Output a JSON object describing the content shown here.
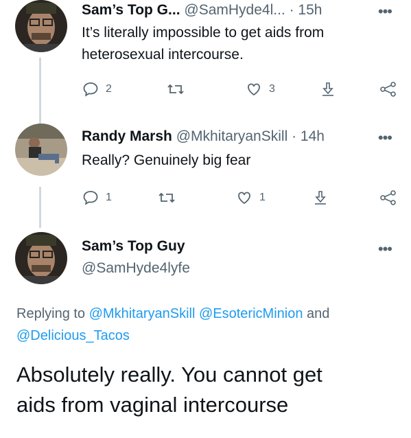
{
  "tweets": [
    {
      "name": "Sam’s Top G...",
      "handle": "@SamHyde4l...",
      "time": "· 15h",
      "more": "•••",
      "text_lines": [
        "It’s literally impossible to get aids from",
        "heterosexual intercourse."
      ],
      "replies": "2",
      "likes": "3"
    },
    {
      "name": "Randy Marsh",
      "handle": "@MkhitaryanSkill",
      "time": "· 14h",
      "more": "•••",
      "text_lines": [
        "Really? Genuinely big fear"
      ],
      "replies": "1",
      "likes": "1"
    }
  ],
  "focused": {
    "name": "Sam’s Top Guy",
    "handle": "@SamHyde4lyfe",
    "more": "•••",
    "replying_prefix": "Replying to",
    "replying_mentions": [
      "@MkhitaryanSkill",
      "@EsotericMinion",
      "@Delicious_Tacos"
    ],
    "replying_and": "and",
    "text_lines": [
      "Absolutely really. You cannot get",
      "aids from vaginal intercourse"
    ]
  },
  "icons": {
    "reply": "reply-icon",
    "retweet": "retweet-icon",
    "like": "heart-icon",
    "share": "share-icon",
    "nodes": "nodes-icon"
  },
  "colors": {
    "link": "#1d9bf0",
    "secondary": "#536471",
    "thread_line": "#cfd9de"
  }
}
